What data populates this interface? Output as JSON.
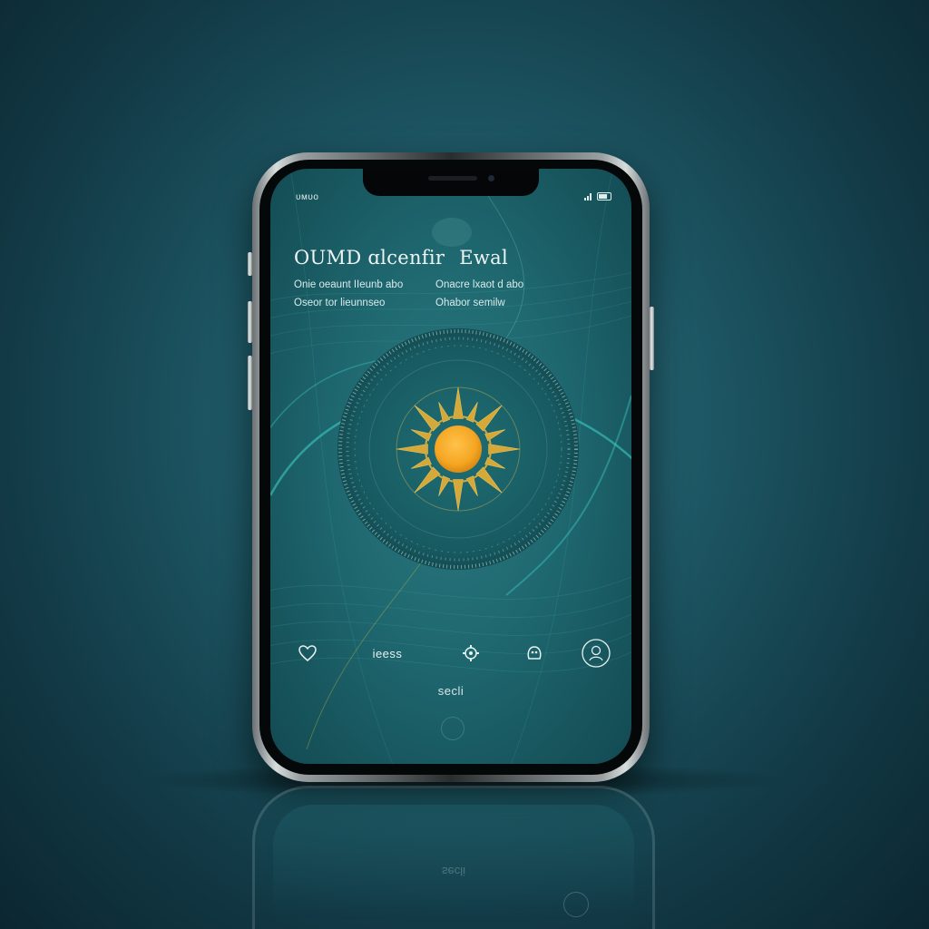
{
  "status_bar": {
    "carrier": "ᴜᴍᴜᴏ"
  },
  "header": {
    "title_part1": "OUMD ɑlcenfir",
    "title_part2": "Ewal"
  },
  "info": {
    "left_line1": "Onie oeaunt IIeunb abo",
    "left_line2": "Oseor tor lieunnseo",
    "right_line1": "Onacre lxaot d abo",
    "right_line2": "Ohabor semilw"
  },
  "nav": {
    "items": [
      {
        "icon": "heart-icon"
      },
      {
        "label": "ieess"
      },
      {
        "icon": "settings-gear-icon"
      },
      {
        "icon": "face-icon"
      },
      {
        "icon": "profile-circle-icon"
      }
    ]
  },
  "footer": {
    "label": "secli"
  },
  "colors": {
    "screen_bg": "#1f6870",
    "sun_core": "#f5a623",
    "sun_rays": "#d4a93a",
    "accent_line": "#3fd6c8"
  }
}
